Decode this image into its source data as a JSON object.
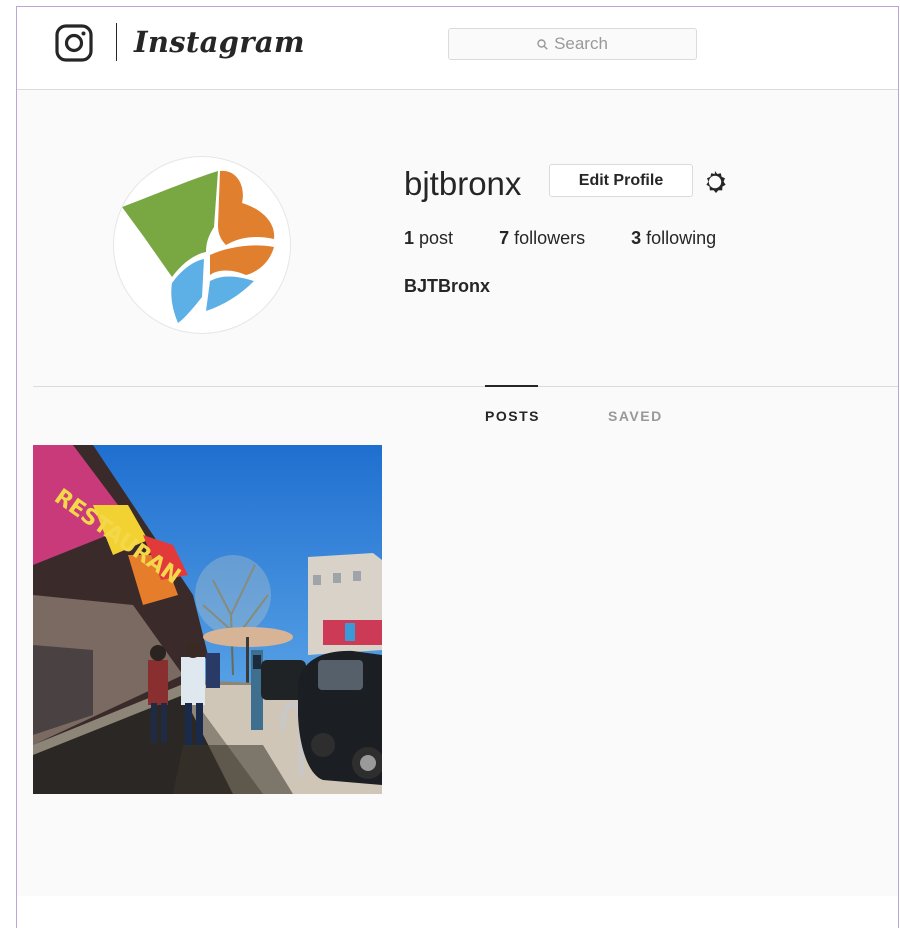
{
  "header": {
    "wordmark": "Instagram",
    "search": {
      "placeholder": "Search"
    }
  },
  "profile": {
    "username": "bjtbronx",
    "edit_button": "Edit Profile",
    "stats": [
      {
        "count": "1",
        "label": "post"
      },
      {
        "count": "7",
        "label": "followers"
      },
      {
        "count": "3",
        "label": "following"
      }
    ],
    "full_name": "BJTBronx"
  },
  "tabs": [
    {
      "label": "POSTS",
      "active": true
    },
    {
      "label": "SAVED",
      "active": false
    }
  ],
  "posts": [
    {
      "kind": "street-photo"
    }
  ],
  "colors": {
    "logo_green": "#79a843",
    "logo_orange": "#e07f2e",
    "logo_blue": "#5cb0e6",
    "sky": "#2f7fd4"
  },
  "icons": [
    "instagram-camera-icon",
    "search-icon",
    "gear-icon"
  ]
}
